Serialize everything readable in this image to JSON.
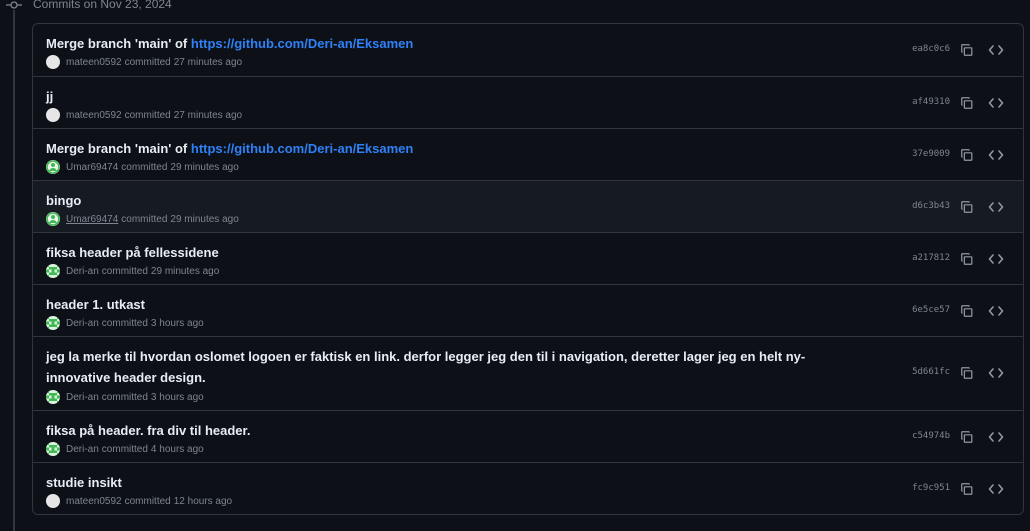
{
  "group": {
    "title": "Commits on Nov 23, 2024"
  },
  "commits": [
    {
      "pre": "Merge branch 'main' of ",
      "link": "https://github.com/Deri-an/Eksamen",
      "message": "",
      "author": "mateen0592",
      "verb": "committed",
      "time": "27 minutes ago",
      "sha": "ea8c0c6",
      "avatar": "plain"
    },
    {
      "pre": "",
      "link": "",
      "message": "jj",
      "author": "mateen0592",
      "verb": "committed",
      "time": "27 minutes ago",
      "sha": "af49310",
      "avatar": "plain"
    },
    {
      "pre": "Merge branch 'main' of ",
      "link": "https://github.com/Deri-an/Eksamen",
      "message": "",
      "author": "Umar69474",
      "verb": "committed",
      "time": "29 minutes ago",
      "sha": "37e9009",
      "avatar": "green"
    },
    {
      "pre": "",
      "link": "",
      "message": "bingo",
      "author": "Umar69474",
      "verb": "committed",
      "time": "29 minutes ago",
      "sha": "d6c3b43",
      "avatar": "green"
    },
    {
      "pre": "",
      "link": "",
      "message": "fiksa header på fellessidene",
      "author": "Deri-an",
      "verb": "committed",
      "time": "29 minutes ago",
      "sha": "a217812",
      "avatar": "pixel"
    },
    {
      "pre": "",
      "link": "",
      "message": "header 1. utkast",
      "author": "Deri-an",
      "verb": "committed",
      "time": "3 hours ago",
      "sha": "6e5ce57",
      "avatar": "pixel"
    },
    {
      "pre": "",
      "link": "",
      "message": "jeg la merke til hvordan oslomet logoen er faktisk en link. derfor legger jeg den til i navigation, deretter lager jeg en helt ny-innovative header design.",
      "author": "Deri-an",
      "verb": "committed",
      "time": "3 hours ago",
      "sha": "5d661fc",
      "avatar": "pixel"
    },
    {
      "pre": "",
      "link": "",
      "message": "fiksa på header. fra div til header.",
      "author": "Deri-an",
      "verb": "committed",
      "time": "4 hours ago",
      "sha": "c54974b",
      "avatar": "pixel"
    },
    {
      "pre": "",
      "link": "",
      "message": "studie insikt",
      "author": "mateen0592",
      "verb": "committed",
      "time": "12 hours ago",
      "sha": "fc9c951",
      "avatar": "plain"
    }
  ],
  "icons": {
    "copy": "copy-icon",
    "browse": "code-icon",
    "commit": "git-commit-icon"
  },
  "colors": {
    "background": "#0d1117",
    "border": "#30363d",
    "link": "#2f81f7",
    "muted": "#7d8590",
    "avatar_green": "#3fb950"
  }
}
